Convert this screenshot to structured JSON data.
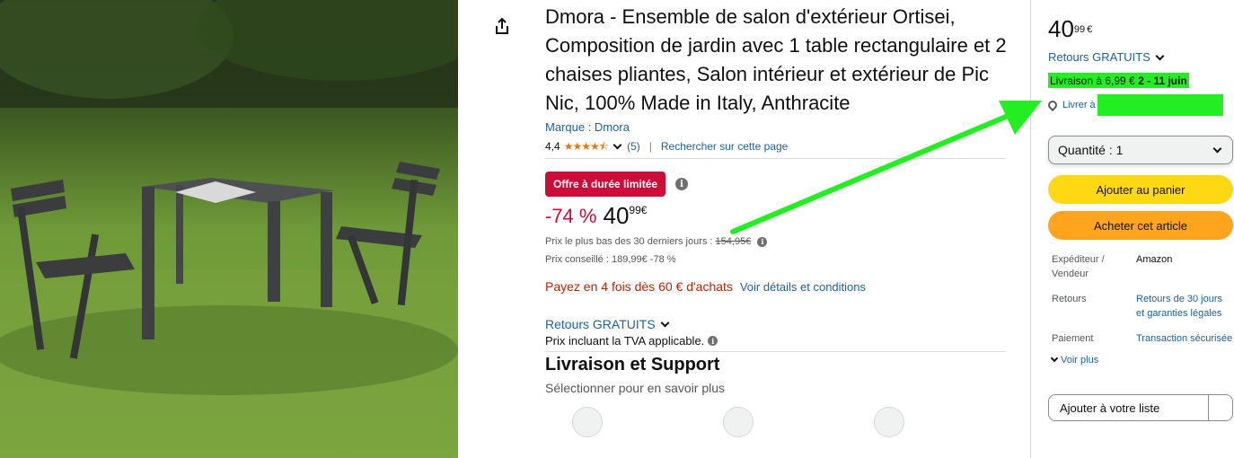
{
  "product": {
    "title": "Dmora - Ensemble de salon d'extérieur Ortisei, Composition de jardin avec 1 table rectangulaire et 2 chaises pliantes, Salon intérieur et extérieur de Pic Nic, 100% Made in Italy, Anthracite",
    "brand": "Marque : Dmora",
    "rating_value": "4,4",
    "rating_stars": "★★★★⯪",
    "review_count": "(5)",
    "search_page": "Rechercher sur cette page"
  },
  "deal": {
    "badge": "Offre à durée limitée",
    "discount": "-74 %",
    "price_whole": "40",
    "price_fraction": "99",
    "currency": "€",
    "lowest_30_label": "Prix le plus bas des 30 derniers jours :",
    "lowest_30_value": "154,95€",
    "msrp": "Prix conseillé : 189,99€ -78 %"
  },
  "installments": {
    "text": "Payez en 4 fois dès 60 € d'achats",
    "link": "Voir détails et conditions"
  },
  "returns": "Retours GRATUITS",
  "tva": "Prix incluant la TVA applicable.",
  "support": {
    "title": "Livraison et Support",
    "subtitle": "Sélectionner pour en savoir plus",
    "icons": [
      "package-icon",
      "return-icon",
      "headset-icon"
    ]
  },
  "buybox": {
    "price_whole": "40",
    "price_fraction": "99",
    "currency": "€",
    "returns": "Retours GRATUITS",
    "delivery_prefix": "Livraison à 6,99 €",
    "delivery_dates": "2 - 11 juin",
    "deliver_to": "Livrer à",
    "quantity_label": "Quantité :",
    "quantity_value": "1",
    "add_to_cart": "Ajouter au panier",
    "buy_now": "Acheter cet article",
    "info": [
      {
        "label": "Expéditeur / Vendeur",
        "value": "Amazon",
        "link": false
      },
      {
        "label": "Retours",
        "value": "Retours de 30 jours et garanties légales",
        "link": true
      },
      {
        "label": "Paiement",
        "value": "Transaction sécurisée",
        "link": true
      }
    ],
    "see_more": "Voir plus",
    "wishlist": "Ajouter à votre liste"
  },
  "colors": {
    "link": "#2162a1",
    "deal_red": "#cc0c39",
    "cart_yellow": "#ffd814",
    "buy_orange": "#ffa41c",
    "annotation_green": "#22ee22"
  }
}
